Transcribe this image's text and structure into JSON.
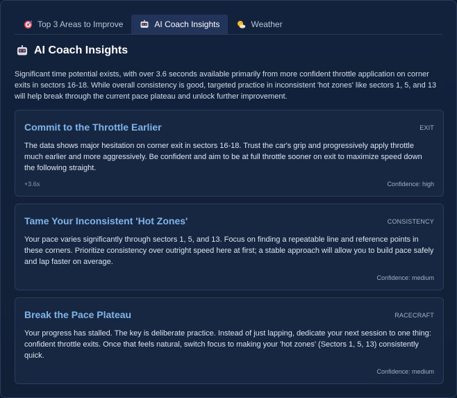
{
  "tabs": [
    {
      "label": "Top 3 Areas to Improve",
      "icon": "target-icon",
      "active": false
    },
    {
      "label": "AI Coach Insights",
      "icon": "robot-icon",
      "active": true
    },
    {
      "label": "Weather",
      "icon": "sun-cloud-icon",
      "active": false
    }
  ],
  "heading": "AI Coach Insights",
  "intro": "Significant time potential exists, with over 3.6 seconds available primarily from more confident throttle application on corner exits in sectors 16-18. While overall consistency is good, targeted practice in inconsistent 'hot zones' like sectors 1, 5, and 13 will help break through the current pace plateau and unlock further improvement.",
  "cards": [
    {
      "title": "Commit to the Throttle Earlier",
      "category": "EXIT",
      "body": "The data shows major hesitation on corner exit in sectors 16-18. Trust the car's grip and progressively apply throttle much earlier and more aggressively. Be confident and aim to be at full throttle sooner on exit to maximize speed down the following straight.",
      "gain": "+3.6s",
      "confidence": "Confidence: high"
    },
    {
      "title": "Tame Your Inconsistent 'Hot Zones'",
      "category": "CONSISTENCY",
      "body": "Your pace varies significantly through sectors 1, 5, and 13. Focus on finding a repeatable line and reference points in these corners. Prioritize consistency over outright speed here at first; a stable approach will allow you to build pace safely and lap faster on average.",
      "gain": "",
      "confidence": "Confidence: medium"
    },
    {
      "title": "Break the Pace Plateau",
      "category": "RACECRAFT",
      "body": "Your progress has stalled. The key is deliberate practice. Instead of just lapping, dedicate your next session to one thing: confident throttle exits. Once that feels natural, switch focus to making your 'hot zones' (Sectors 1, 5, 13) consistently quick.",
      "gain": "",
      "confidence": "Confidence: medium"
    }
  ],
  "colors": {
    "accent": "#7fb4ea",
    "active_tab": "#22345a",
    "background": "#13223c"
  }
}
